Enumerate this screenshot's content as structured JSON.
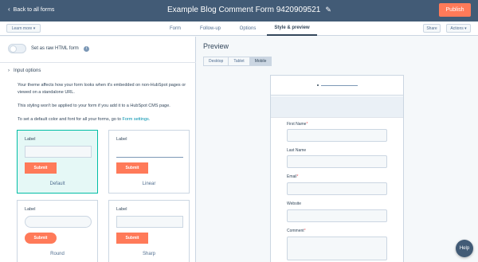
{
  "topbar": {
    "back_label": "Back to all forms",
    "form_title": "Example Blog Comment Form 9420909521",
    "publish_label": "Publish"
  },
  "subbar": {
    "learn_more": "Learn more",
    "tabs": [
      {
        "label": "Form",
        "active": false
      },
      {
        "label": "Follow-up",
        "active": false
      },
      {
        "label": "Options",
        "active": false
      },
      {
        "label": "Style & preview",
        "active": true
      }
    ],
    "share_label": "Share",
    "actions_label": "Actions"
  },
  "left": {
    "raw_html_label": "Set as raw HTML form",
    "section_title": "Input options",
    "paragraphs": [
      "Your theme affects how your form looks when it's embedded on non-HubSpot pages or viewed on a standalone URL.",
      "This styling won't be applied to your form if you add it to a HubSpot CMS page."
    ],
    "default_text": "To set a default color and font for all your forms, go to",
    "settings_link": "Form settings.",
    "style_cards": [
      {
        "name": "Default",
        "field_label": "Label",
        "submit": "Submit",
        "selected": true
      },
      {
        "name": "Linear",
        "field_label": "Label",
        "submit": "Submit",
        "selected": false
      },
      {
        "name": "Round",
        "field_label": "Label",
        "submit": "Submit",
        "selected": false
      },
      {
        "name": "Sharp",
        "field_label": "Label",
        "submit": "Submit",
        "selected": false
      }
    ]
  },
  "preview": {
    "title": "Preview",
    "device_tabs": [
      {
        "label": "Desktop",
        "active": false
      },
      {
        "label": "Tablet",
        "active": false
      },
      {
        "label": "Mobile",
        "active": true
      }
    ],
    "fields": [
      {
        "label": "First Name",
        "required": true
      },
      {
        "label": "Last Name",
        "required": false
      },
      {
        "label": "Email",
        "required": true
      },
      {
        "label": "Website",
        "required": false
      },
      {
        "label": "Comment",
        "required": true
      }
    ]
  },
  "help_label": "Help",
  "colors": {
    "topbar": "#425b76",
    "accent": "#ff7a59",
    "selected_border": "#00bda5",
    "link": "#0091ae"
  }
}
